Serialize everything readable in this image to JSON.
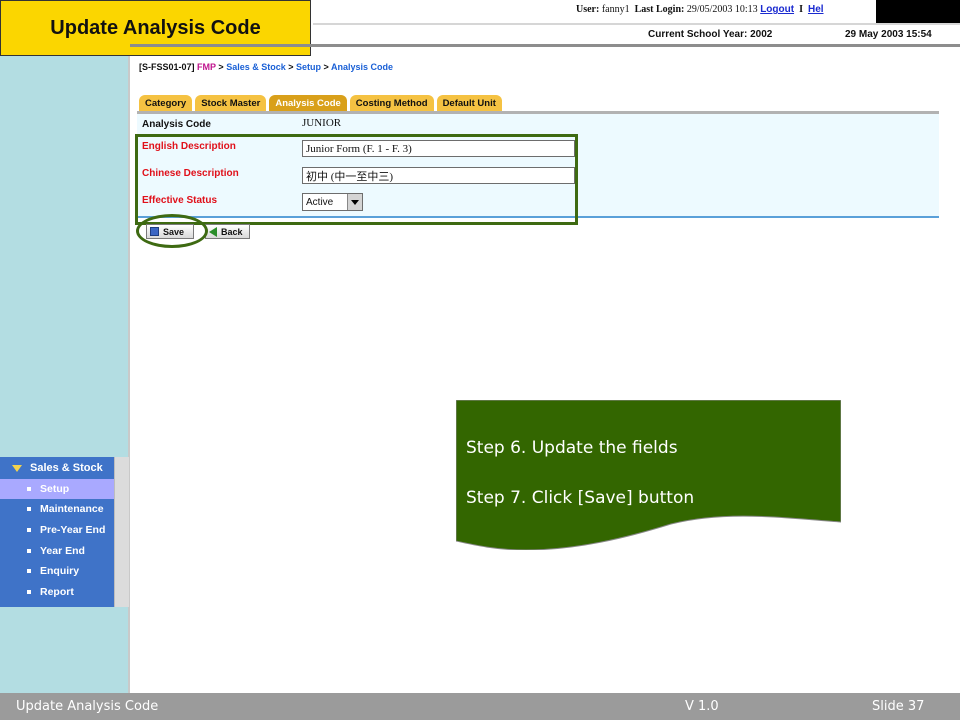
{
  "slide_title": "Update Analysis Code",
  "header": {
    "user_label": "User:",
    "user_name": "fanny1",
    "last_login_label": "Last Login:",
    "last_login_value": "29/05/2003 10:13",
    "logout_link": "Logout",
    "separator": "I",
    "help_link": "Hel",
    "school_year": "Current School Year: 2002",
    "date_time": "29 May 2003 15:54"
  },
  "breadcrumb": {
    "code": "[S-FSS01-07]",
    "fmp": "FMP",
    "sep": ">",
    "items": [
      "Sales & Stock",
      "Setup",
      "Analysis Code"
    ]
  },
  "tabs": [
    {
      "label": "Category"
    },
    {
      "label": "Stock Master"
    },
    {
      "label": "Analysis Code",
      "active": true
    },
    {
      "label": "Costing Method"
    },
    {
      "label": "Default Unit"
    }
  ],
  "form": {
    "analysis_code_label": "Analysis Code",
    "analysis_code_value": "JUNIOR",
    "english_label": "English Description",
    "english_value": "Junior Form (F. 1 - F. 3)",
    "chinese_label": "Chinese Description",
    "chinese_value": "初中 (中一至中三)",
    "status_label": "Effective Status",
    "status_value": "Active"
  },
  "buttons": {
    "save": "Save",
    "back": "Back"
  },
  "sidebar": {
    "header": "Sales & Stock",
    "items": [
      {
        "label": "Setup",
        "active": true
      },
      {
        "label": "Maintenance"
      },
      {
        "label": "Pre-Year End"
      },
      {
        "label": "Year End"
      },
      {
        "label": "Enquiry"
      },
      {
        "label": "Report"
      }
    ]
  },
  "callout": {
    "step6": "Step 6. Update the fields",
    "step7": "Step 7. Click [Save] button"
  },
  "footer": {
    "left": "Update Analysis Code",
    "version": "V 1.0",
    "slide": "Slide 37"
  },
  "colors": {
    "title_box": "#fbd600",
    "callout_fill": "#336600",
    "highlight": "#3e6a12",
    "required_label": "#e0101a",
    "link": "#1a2ad0",
    "tab": "#f5c242",
    "tab_active": "#d9a01a"
  }
}
